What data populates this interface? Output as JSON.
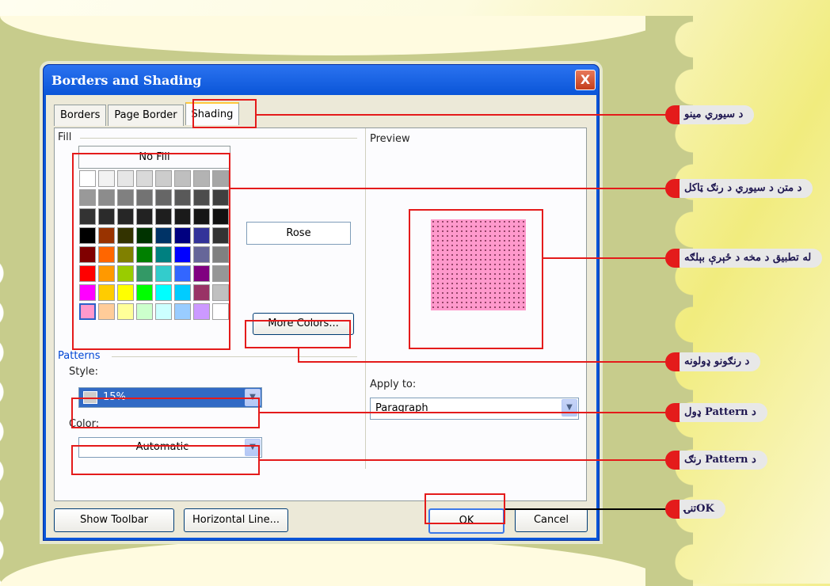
{
  "dialog": {
    "title": "Borders and Shading",
    "close_glyph": "X",
    "tabs": [
      "Borders",
      "Page Border",
      "Shading"
    ],
    "fill": {
      "label": "Fill",
      "no_fill": "No Fill",
      "selected_color_name": "Rose",
      "more_colors": "More Colors..."
    },
    "patterns": {
      "label": "Patterns",
      "style_label": "Style:",
      "style_value": "15%",
      "color_label": "Color:",
      "color_value": "Automatic"
    },
    "preview": {
      "label": "Preview",
      "apply_to_label": "Apply to:",
      "apply_to_value": "Paragraph"
    },
    "buttons": {
      "show_toolbar": "Show Toolbar",
      "horizontal_line": "Horizontal Line...",
      "ok": "OK",
      "cancel": "Cancel"
    },
    "palette": [
      [
        "#ffffff",
        "#f2f2f2",
        "#e6e6e6",
        "#d9d9d9",
        "#cccccc",
        "#bfbfbf",
        "#b3b3b3",
        "#a6a6a6"
      ],
      [
        "#999999",
        "#8c8c8c",
        "#808080",
        "#737373",
        "#666666",
        "#595959",
        "#4d4d4d",
        "#404040"
      ],
      [
        "#333333",
        "#2b2b2b",
        "#262626",
        "#222222",
        "#1e1e1e",
        "#1a1a1a",
        "#161616",
        "#111111"
      ],
      [
        "#000000",
        "#993300",
        "#333300",
        "#003300",
        "#003366",
        "#000080",
        "#333399",
        "#333333"
      ],
      [
        "#800000",
        "#ff6600",
        "#808000",
        "#008000",
        "#008080",
        "#0000ff",
        "#666699",
        "#808080"
      ],
      [
        "#ff0000",
        "#ff9900",
        "#99cc00",
        "#339966",
        "#33cccc",
        "#3366ff",
        "#800080",
        "#969696"
      ],
      [
        "#ff00ff",
        "#ffcc00",
        "#ffff00",
        "#00ff00",
        "#00ffff",
        "#00ccff",
        "#993366",
        "#c0c0c0"
      ],
      [
        "#ff99cc",
        "#ffcc99",
        "#ffff99",
        "#ccffcc",
        "#ccffff",
        "#99ccff",
        "#cc99ff",
        "#ffffff"
      ]
    ],
    "selected_swatch": [
      7,
      0
    ]
  },
  "callouts": {
    "tabs_menu": "د سيوري مينو",
    "color_table": "د متن د سيوري د رنګ ټاکل",
    "preview": "له تطبيق د مخه د ځېرې بېلګه",
    "more_colors": "د رنګونو ډولونه",
    "pattern_style": "د Pattern ډول",
    "pattern_color": "د Pattern رنګ",
    "ok": "OKتنۍ"
  },
  "colors": {
    "accent_red": "#e41b1b",
    "titlebar_blue": "#0a55d8",
    "rose": "#ff99cc"
  }
}
